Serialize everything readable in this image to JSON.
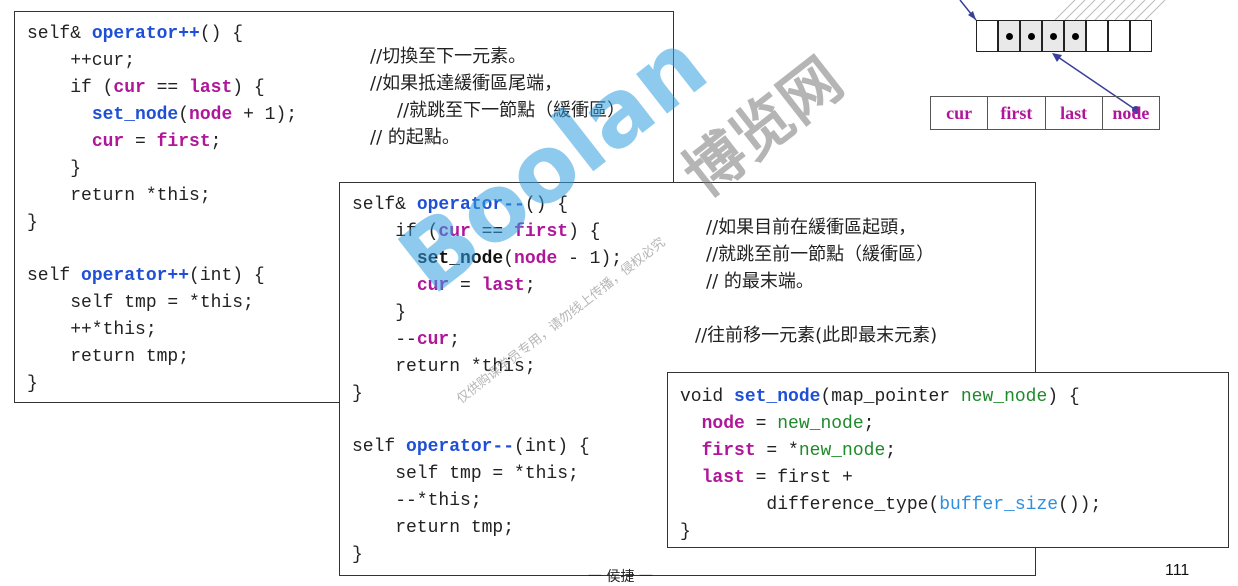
{
  "box1": {
    "l1": {
      "a": "self& ",
      "b": "operator++",
      "c": "() {"
    },
    "l2": {
      "code": "    ++cur;",
      "comment": "//切換至下一元素。"
    },
    "l3": {
      "a": "    if (",
      "b": "cur",
      "c": " == ",
      "d": "last",
      "e": ") {",
      "comment": "//如果抵達緩衝區尾端，"
    },
    "l4": {
      "a": "      ",
      "b": "set_node",
      "c": "(",
      "d": "node",
      "e": " + 1);",
      "comment": "//就跳至下一節點（緩衝區）"
    },
    "l5": {
      "a": "      ",
      "b": "cur",
      "c": " = ",
      "d": "first",
      "e": ";",
      "comment": "// 的起點。"
    },
    "l6": "    }",
    "l7": "    return *this;",
    "l8": "}",
    "l9": {
      "a": "self ",
      "b": "operator++",
      "c": "(int) {"
    },
    "l10": "    self tmp = *this;",
    "l11": "    ++*this;",
    "l12": "    return tmp;",
    "l13": "}"
  },
  "box2": {
    "l1": {
      "a": "self& ",
      "b": "operator--",
      "c": "() {"
    },
    "l2": {
      "a": "    if (",
      "b": "cur",
      "c": " == ",
      "d": "first",
      "e": ") {",
      "comment": "//如果目前在緩衝區起頭，"
    },
    "l3": {
      "a": "      ",
      "b": "set_node",
      "c": "(",
      "d": "node",
      "e": " - 1);",
      "comment": "//就跳至前一節點（緩衝區）"
    },
    "l4": {
      "a": "      ",
      "b": "cur",
      "c": " = ",
      "d": "last",
      "e": ";",
      "comment": "// 的最末端。"
    },
    "l5": "    }",
    "l6": {
      "a": "    --",
      "b": "cur",
      "c": ";",
      "comment": "//往前移一元素(此即最末元素)"
    },
    "l7": "    return *this;",
    "l8": "}",
    "l9": {
      "a": "self ",
      "b": "operator--",
      "c": "(int) {"
    },
    "l10": "    self tmp = *this;",
    "l11": "    --*this;",
    "l12": "    return tmp;",
    "l13": "}"
  },
  "box3": {
    "l1": {
      "a": "void ",
      "b": "set_node",
      "c": "(map_pointer ",
      "d": "new_node",
      "e": ") {"
    },
    "l2": {
      "a": "  ",
      "b": "node",
      "c": " = ",
      "d": "new_node",
      "e": ";"
    },
    "l3": {
      "a": "  ",
      "b": "first",
      "c": " = *",
      "d": "new_node",
      "e": ";"
    },
    "l4": {
      "a": "  ",
      "b": "last",
      "c": " = first +"
    },
    "l5": {
      "a": "        difference_type(",
      "b": "buffer_size",
      "c": "());"
    },
    "l6": "}"
  },
  "iterator": {
    "cells": [
      "cur",
      "first",
      "last",
      "node"
    ]
  },
  "buffer": {
    "slots": 8,
    "dots": [
      1,
      2,
      3,
      4
    ]
  },
  "watermark": {
    "brand": "Boolan",
    "cn": "博览网",
    "note": "仅供购课学员专用，请勿线上传播，侵权必究"
  },
  "footer": {
    "mark": "一 侯捷 一"
  },
  "page": {
    "number": "111"
  },
  "colors": {
    "keyword": "#1f4fd6",
    "member": "#b0169a",
    "func": "#2e8fe0",
    "param": "#1f8a2c",
    "watermark": "#2f9fe0"
  }
}
